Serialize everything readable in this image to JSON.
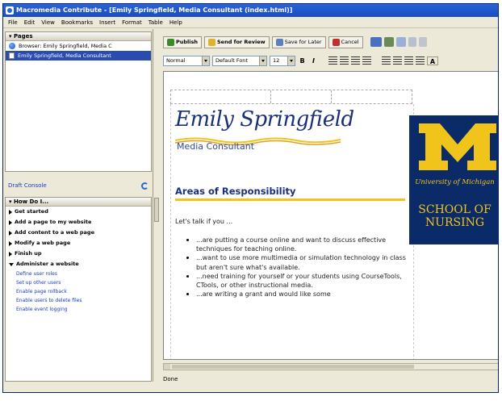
{
  "window": {
    "title": "Macromedia Contribute - [Emily Springfield, Media Consultant (index.html)]"
  },
  "menu": [
    "File",
    "Edit",
    "View",
    "Bookmarks",
    "Insert",
    "Format",
    "Table",
    "Help"
  ],
  "pages_panel": {
    "title": "Pages",
    "items": [
      {
        "label": "Browser: Emily Springfield, Media C",
        "icon": "globe-icon"
      },
      {
        "label": "Emily Springfield, Media Consultant",
        "icon": "document-icon",
        "selected": true
      }
    ],
    "draft_console": "Draft Console"
  },
  "howto_panel": {
    "title": "How Do I...",
    "items": [
      "Get started",
      "Add a page to my website",
      "Add content to a web page",
      "Modify a web page",
      "Finish up"
    ],
    "expanded": {
      "label": "Administer a website",
      "links": [
        "Define user roles",
        "Set up other users",
        "Enable page rollback",
        "Enable users to delete files",
        "Enable event logging"
      ]
    }
  },
  "toolbar": {
    "publish": "Publish",
    "send_for_review": "Send for Review",
    "save_for_later": "Save for Later",
    "cancel": "Cancel"
  },
  "format_bar": {
    "style": "Normal",
    "font": "Default Font",
    "size": "12",
    "bold": "B",
    "italic": "I"
  },
  "page": {
    "name": "Emily Springfield",
    "subtitle": "Media Consultant",
    "section_heading": "Areas of Responsibility",
    "intro": "Let's talk if you ...",
    "bullets": [
      "...are putting a course online and want to discuss effective techniques for teaching online.",
      "...want to use more multimedia or simulation technology in class but aren't sure what's available.",
      "...need training for yourself or your students using CourseTools, CTools, or other instructional media.",
      "...are writing a grant and would like some"
    ],
    "logo": {
      "letter": "M",
      "university": "University of Michigan",
      "school_line1": "SCHOOL OF",
      "school_line2": "NURSING",
      "colors": {
        "navy": "#0a2a68",
        "maize": "#f0c41b"
      }
    }
  },
  "status": "Done"
}
